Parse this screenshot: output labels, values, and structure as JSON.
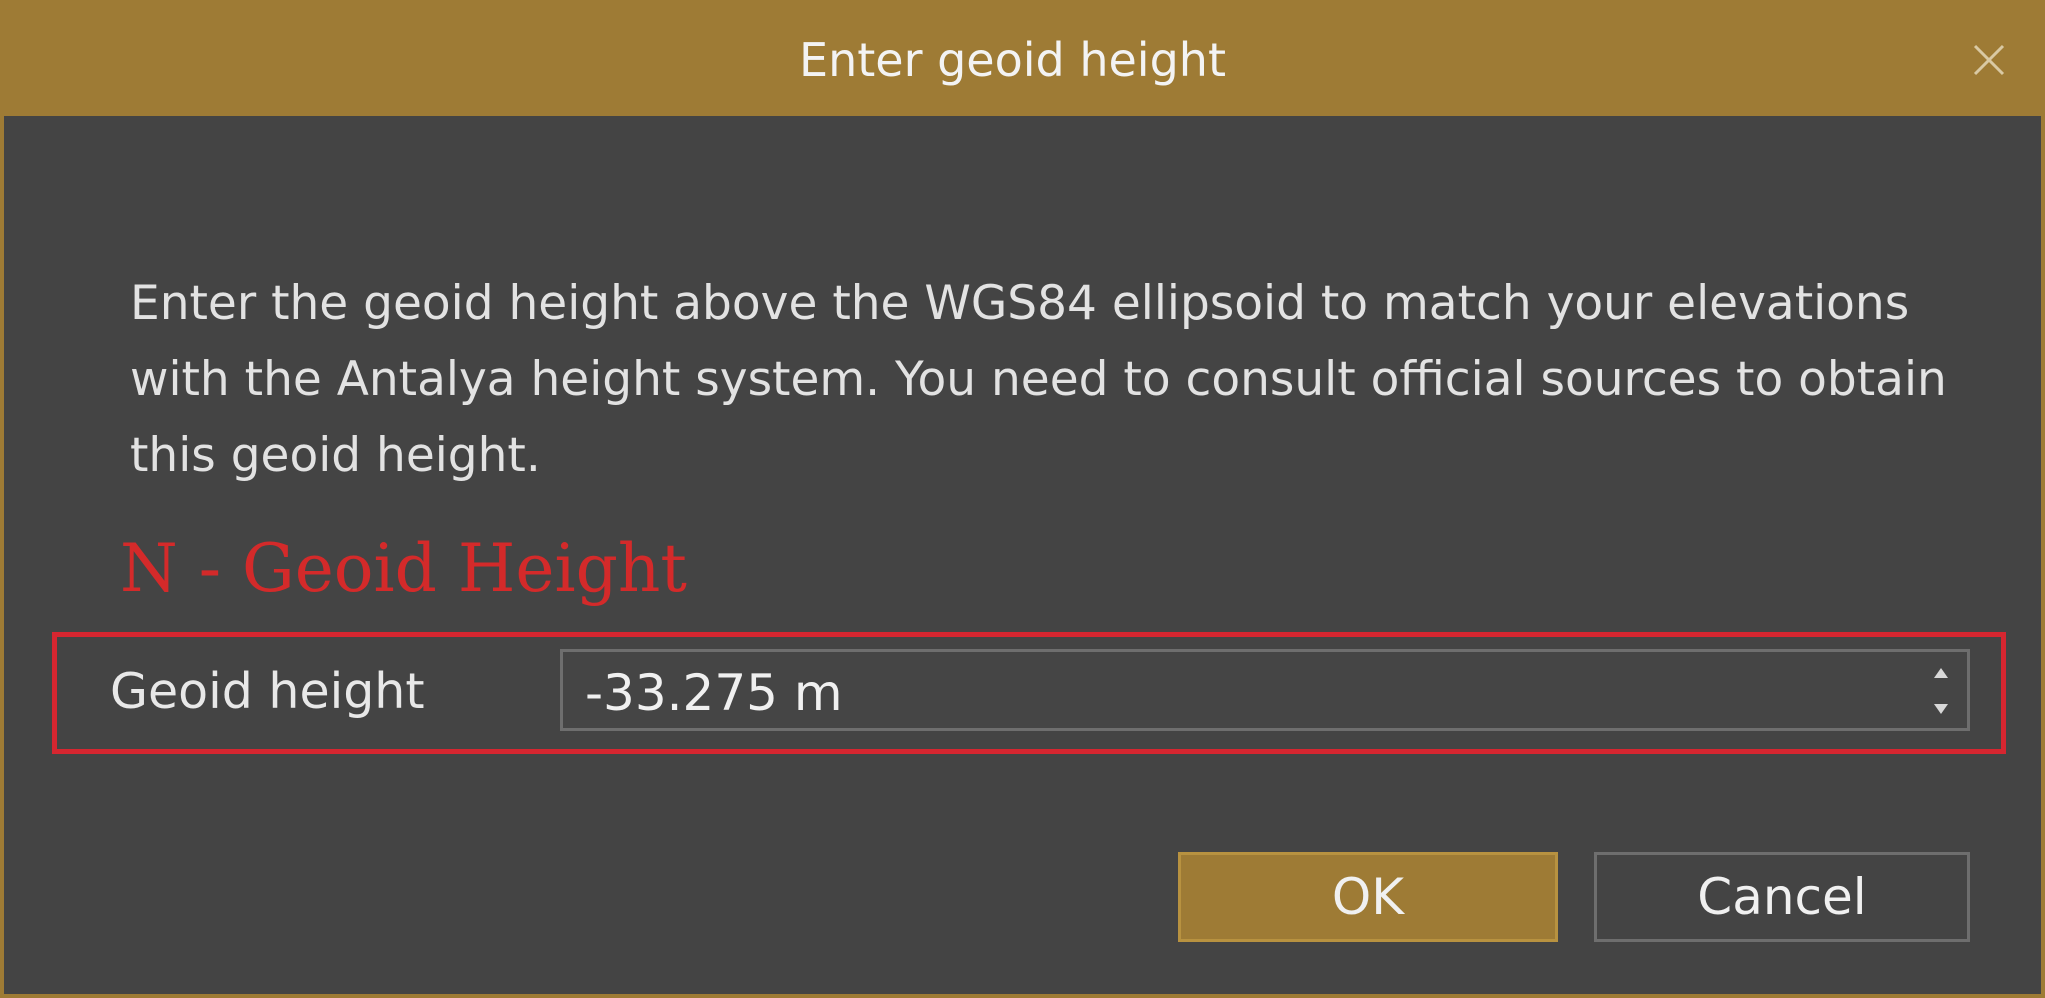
{
  "dialog": {
    "title": "Enter geoid height",
    "close_icon": "close-icon",
    "description": "Enter the geoid height above the WGS84 ellipsoid to match your elevations with the Antalya height system. You need to consult official sources to obtain this geoid height.",
    "annotation": "N - Geoid Height",
    "field": {
      "label": "Geoid height",
      "value": "-33.275 m"
    },
    "buttons": {
      "ok_label": "OK",
      "cancel_label": "Cancel"
    }
  },
  "colors": {
    "accent": "#9e7b35",
    "background": "#444444",
    "annotation_red": "#d62630",
    "text": "#e2e2e2"
  }
}
